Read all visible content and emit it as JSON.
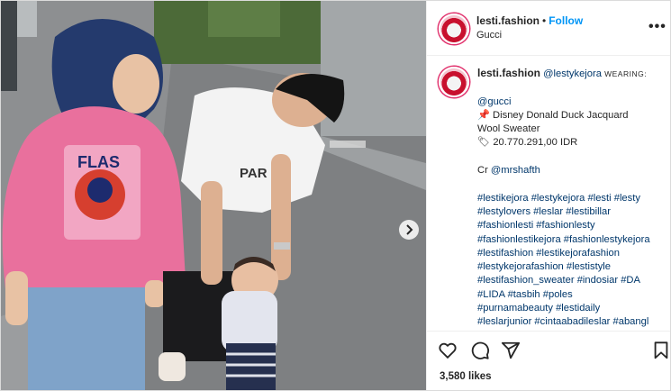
{
  "post": {
    "username": "lesti.fashion",
    "separator": "•",
    "follow_label": "Follow",
    "location": "Gucci",
    "more_label": "•••"
  },
  "caption": {
    "username": "lesti.fashion",
    "mention": "@lestykejora",
    "wearing": "WEARING:",
    "brand": "@gucci",
    "pin_emoji": "📌",
    "item_line1": "Disney Donald Duck Jacquard",
    "item_line2": "Wool Sweater",
    "price_emoji": "🏷",
    "price": "20.770.291,00 IDR",
    "credit_prefix": "Cr",
    "credit_user": "@mrshafth",
    "hashtag_lines": [
      "#lestikejora #lestykejora #lesti #lesty",
      "#lestylovers #leslar #lestibillar",
      "#fashionlesti #fashionlesty",
      "#fashionlestikejora #fashionlestykejora",
      "#lestifashion #lestikejorafashion",
      "#lestykejorafashion #lestistyle",
      "#lestifashion_sweater #indosiar #DA",
      "#LIDA #tasbih #poles",
      "#purnamabeauty #lestidaily",
      "#leslarjunior #cintaabadileslar #abangl"
    ]
  },
  "actions": {
    "likes": "3,580 likes"
  },
  "icons": {
    "heart": "heart-icon",
    "comment": "comment-icon",
    "share": "share-icon",
    "save": "bookmark-icon",
    "next": "chevron-right-icon"
  },
  "colors": {
    "link": "#00376b",
    "follow": "#0095f6",
    "sweater": "#e9709d",
    "hijab": "#223a70"
  }
}
